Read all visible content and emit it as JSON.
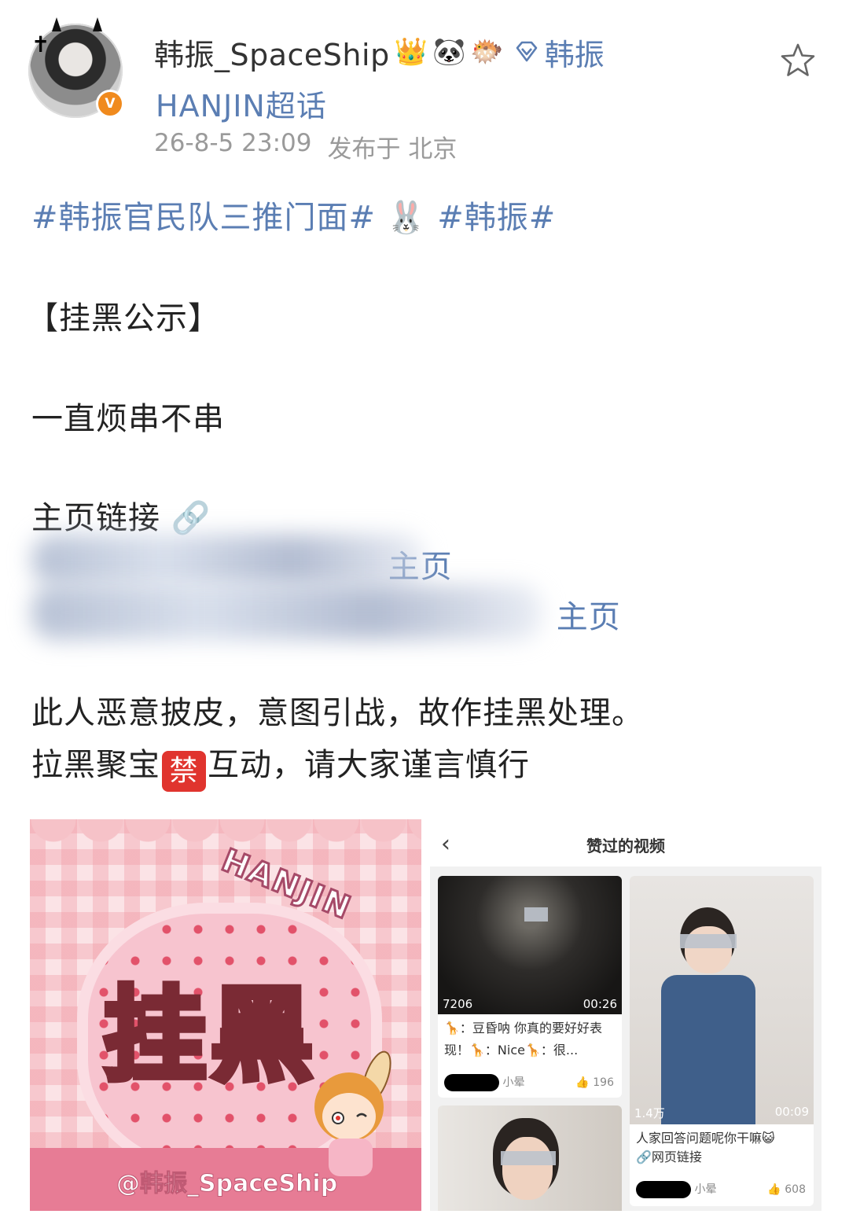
{
  "post": {
    "username": "韩振_SpaceShip",
    "badges": [
      "👑",
      "🐼",
      "🐡"
    ],
    "tag_name": "韩振",
    "supertopic": "HANJIN超话",
    "timestamp": "26-8-5 23:09",
    "location": "发布于 北京",
    "verified_mark": "V"
  },
  "content": {
    "hashtag1": "#韩振官民队三推门面#",
    "hashtag_emoji": "🐰",
    "hashtag2": "#韩振#",
    "heading": "【挂黑公示】",
    "line1": "一直烦串不串",
    "link_label": "主页链接",
    "link_emoji": "🔗",
    "link1_tail": "主页",
    "link2_tail": "主页",
    "warning1": "此人恶意披皮，意图引战，故作挂黑处理。",
    "warning2_before": "拉黑聚宝",
    "ban_mark": "禁",
    "warning2_after": "互动，请大家谨言慎行"
  },
  "image1": {
    "top_word": "HANJIN",
    "big_word": "挂黑",
    "watermark": "@韩振_SpaceShip"
  },
  "image2": {
    "title": "赞过的视频",
    "card1": {
      "views": "7206",
      "duration": "00:26",
      "caption": "🦒：豆昏呐 你真的要好好表现！🦒：Nice🦒：很...",
      "author": "小晕",
      "likes": "196"
    },
    "card2": {
      "views": "1.4万",
      "duration": "00:09",
      "caption": "人家回答问题呢你干嘛😺",
      "link": "🔗网页链接",
      "author": "小晕",
      "likes": "608"
    }
  },
  "colors": {
    "link_blue": "#5b7eb3",
    "verified_orange": "#f08a1d",
    "ban_red": "#e0342e",
    "pink_bg": "#fbe3e6"
  },
  "icons": [
    "star-icon",
    "diamond-icon",
    "chevron-left-icon",
    "thumb-up-icon",
    "verified-icon"
  ]
}
